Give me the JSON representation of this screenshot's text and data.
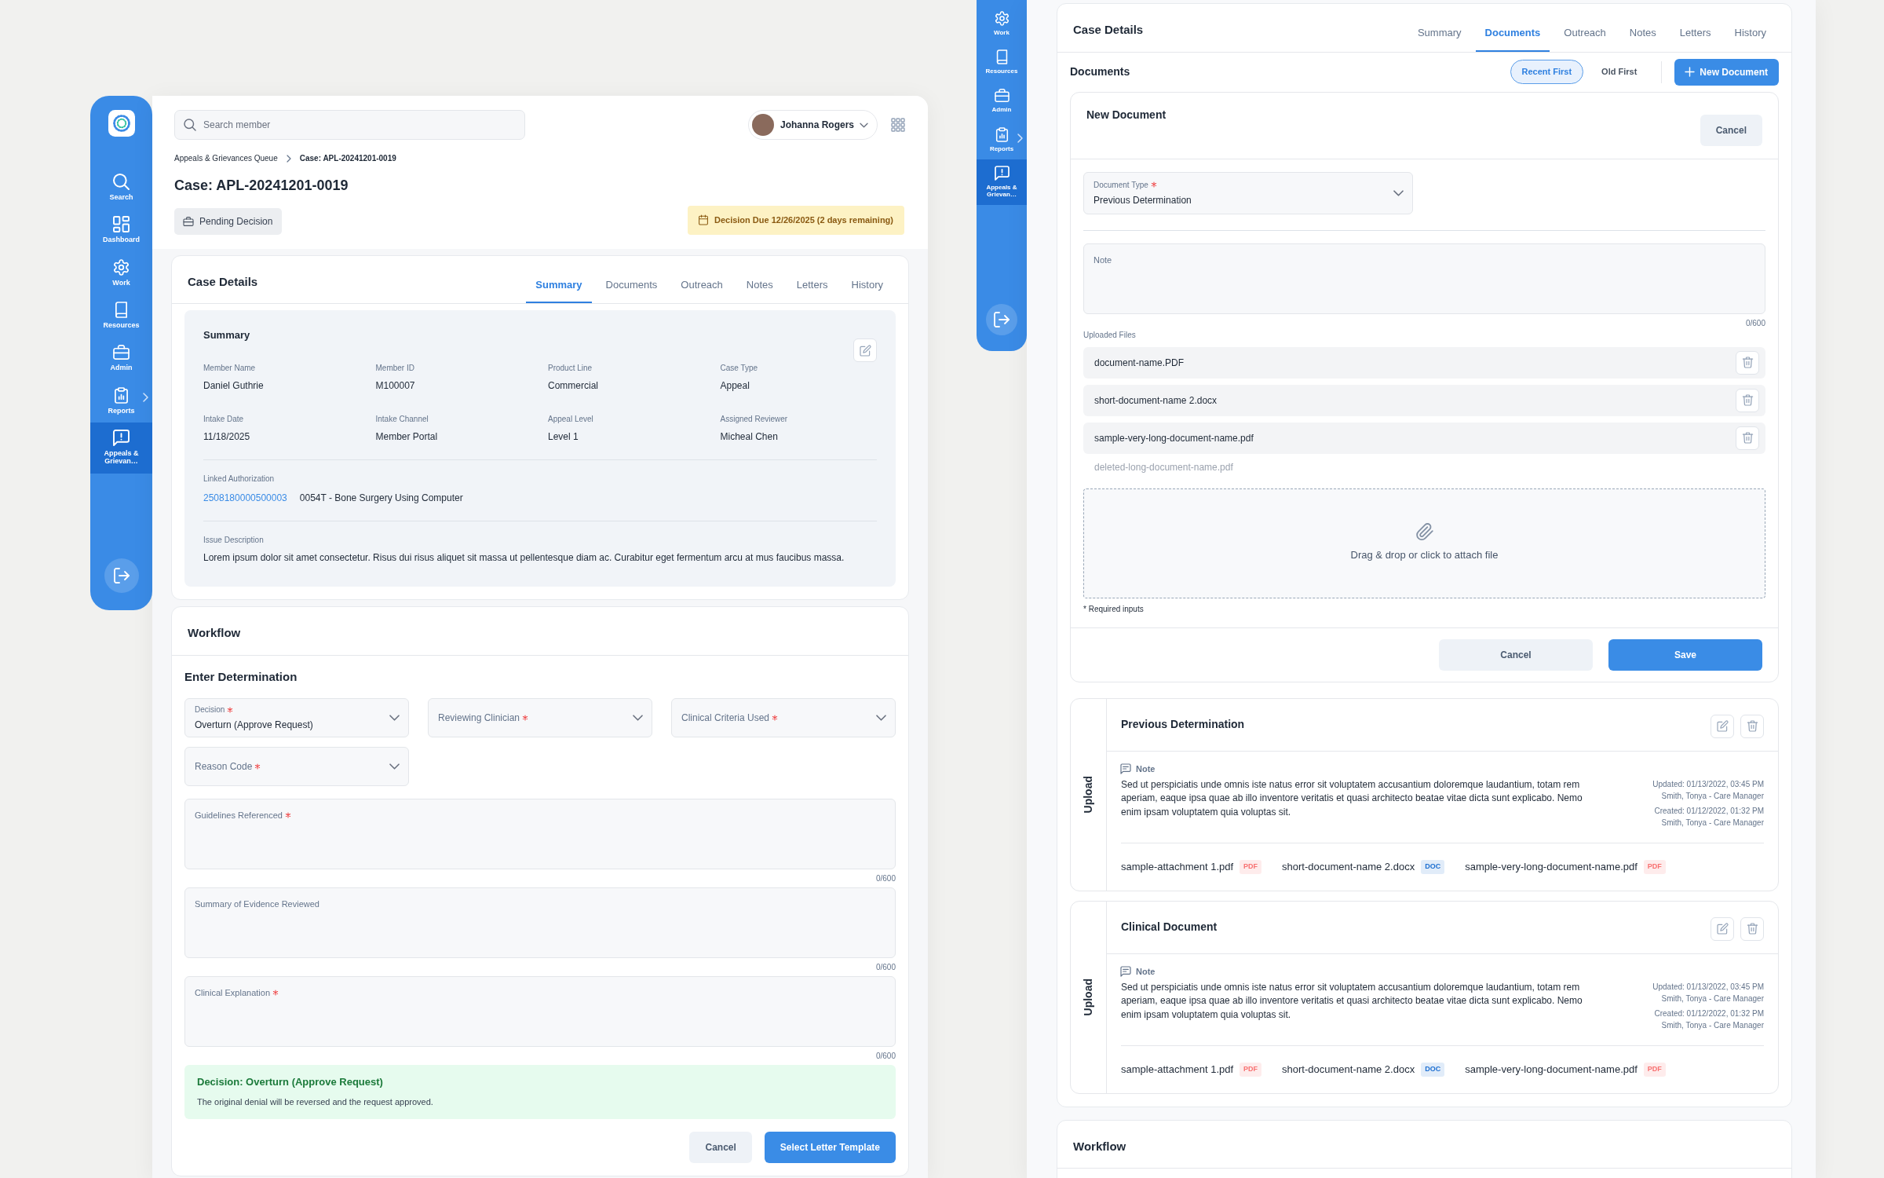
{
  "left_screen": {
    "sidebar": {
      "items": [
        {
          "label": "Search",
          "selected": false,
          "has_submenu": false
        },
        {
          "label": "Dashboard",
          "selected": false,
          "has_submenu": false
        },
        {
          "label": "Work",
          "selected": false,
          "has_submenu": false
        },
        {
          "label": "Resources",
          "selected": false,
          "has_submenu": false
        },
        {
          "label": "Admin",
          "selected": false,
          "has_submenu": false
        },
        {
          "label": "Reports",
          "selected": false,
          "has_submenu": true
        },
        {
          "label": "Appeals & Grievan…",
          "selected": true,
          "has_submenu": false
        }
      ]
    },
    "search": {
      "placeholder": "Search member"
    },
    "user": {
      "name": "Johanna Rogers"
    },
    "breadcrumb": [
      {
        "label": "Appeals & Grievances Queue"
      },
      {
        "label": "Case: APL-20241201-0019"
      }
    ],
    "title": "Case: APL-20241201-0019",
    "status": "Pending Decision",
    "due": "Decision Due 12/26/2025 (2 days remaining)",
    "case_details": {
      "title": "Case Details",
      "tabs": [
        {
          "label": "Summary",
          "selected": true
        },
        {
          "label": "Documents",
          "selected": false
        },
        {
          "label": "Outreach",
          "selected": false
        },
        {
          "label": "Notes",
          "selected": false
        },
        {
          "label": "Letters",
          "selected": false
        },
        {
          "label": "History",
          "selected": false
        }
      ],
      "summary": {
        "title": "Summary",
        "fields": [
          {
            "label": "Member Name",
            "value": "Daniel Guthrie"
          },
          {
            "label": "Member ID",
            "value": "M100007"
          },
          {
            "label": "Product Line",
            "value": "Commercial"
          },
          {
            "label": "Case Type",
            "value": "Appeal"
          },
          {
            "label": "Intake Date",
            "value": "11/18/2025"
          },
          {
            "label": "Intake Channel",
            "value": "Member Portal"
          },
          {
            "label": "Appeal Level",
            "value": "Level 1"
          },
          {
            "label": "Assigned Reviewer",
            "value": "Micheal Chen"
          }
        ],
        "linked_authorization": {
          "label": "Linked Authorization",
          "link": "2508180000500003",
          "description": "0054T - Bone Surgery Using Computer"
        },
        "issue_description": {
          "label": "Issue Description",
          "text": "Lorem ipsum dolor sit amet consectetur. Risus dui risus aliquet sit massa ut pellentesque diam ac. Curabitur eget fermentum arcu at mus faucibus massa."
        }
      }
    },
    "workflow": {
      "title": "Workflow",
      "section_title": "Enter Determination",
      "selects": [
        {
          "label": "Decision",
          "required": true,
          "value": "Overturn (Approve Request)"
        },
        {
          "label": "Reviewing Clinician",
          "required": true
        },
        {
          "label": "Clinical Criteria Used",
          "required": true
        },
        {
          "label": "Reason Code",
          "required": true
        }
      ],
      "textareas": [
        {
          "label": "Guidelines Referenced",
          "required": true,
          "counter": "0/600"
        },
        {
          "label": "Summary of Evidence Reviewed",
          "required": false,
          "counter": "0/600"
        },
        {
          "label": "Clinical Explanation",
          "required": true,
          "counter": "0/600"
        }
      ],
      "alert": {
        "title": "Decision: Overturn (Approve Request)",
        "text": "The original denial will be reversed and the request approved."
      },
      "buttons": [
        {
          "label": "Cancel",
          "kind": "secondary"
        },
        {
          "label": "Select Letter Template",
          "kind": "primary"
        }
      ]
    }
  },
  "right_screen": {
    "sidebar": {
      "items": [
        {
          "label": "Work",
          "selected": false,
          "has_submenu": false
        },
        {
          "label": "Resources",
          "selected": false,
          "has_submenu": false
        },
        {
          "label": "Admin",
          "selected": false,
          "has_submenu": false
        },
        {
          "label": "Reports",
          "selected": false,
          "has_submenu": true
        },
        {
          "label": "Appeals & Grievan…",
          "selected": true,
          "has_submenu": false
        }
      ]
    },
    "case_details": {
      "title": "Case Details",
      "tabs": [
        {
          "label": "Summary",
          "selected": false
        },
        {
          "label": "Documents",
          "selected": true
        },
        {
          "label": "Outreach",
          "selected": false
        },
        {
          "label": "Notes",
          "selected": false
        },
        {
          "label": "Letters",
          "selected": false
        },
        {
          "label": "History",
          "selected": false
        }
      ]
    },
    "documents": {
      "title": "Documents",
      "sort_options": [
        {
          "label": "Recent First",
          "selected": true
        },
        {
          "label": "Old First",
          "selected": false
        }
      ],
      "new_button": "New Document",
      "new_document": {
        "title": "New Document",
        "cancel": "Cancel",
        "document_type": {
          "label": "Document Type",
          "required": true,
          "value": "Previous Determination"
        },
        "note": {
          "label": "Note",
          "counter": "0/600"
        },
        "uploaded_files_label": "Uploaded Files",
        "files": [
          {
            "name": "document-name.PDF",
            "deleted": false
          },
          {
            "name": "short-document-name 2.docx",
            "deleted": false
          },
          {
            "name": "sample-very-long-document-name.pdf",
            "deleted": false
          },
          {
            "name": "deleted-long-document-name.pdf",
            "deleted": true
          }
        ],
        "dropzone": "Drag & drop or click to attach file",
        "required_note": "* Required inputs",
        "buttons": [
          {
            "label": "Cancel",
            "kind": "secondary"
          },
          {
            "label": "Save",
            "kind": "primary"
          }
        ]
      },
      "entries": [
        {
          "side_label": "Upload",
          "title": "Previous Determination",
          "note_label": "Note",
          "note": "Sed ut perspiciatis unde omnis iste natus error sit voluptatem accusantium doloremque laudantium, totam rem aperiam, eaque ipsa quae ab illo inventore veritatis et quasi architecto beatae vitae dicta sunt explicabo. Nemo enim ipsam voluptatem quia voluptas sit.",
          "updated": "Updated: 01/13/2022, 03:45 PM",
          "updated_by": "Smith, Tonya - Care Manager",
          "created": "Created: 01/12/2022, 01:32 PM",
          "created_by": "Smith, Tonya - Care Manager",
          "attachments": [
            {
              "name": "sample-attachment 1.pdf",
              "type": "PDF",
              "color": "#f87171"
            },
            {
              "name": "short-document-name 2.docx",
              "type": "DOC",
              "color": "#1d6fd1"
            },
            {
              "name": "sample-very-long-document-name.pdf",
              "type": "PDF",
              "color": "#f87171"
            }
          ]
        },
        {
          "side_label": "Upload",
          "title": "Clinical Document",
          "note_label": "Note",
          "note": "Sed ut perspiciatis unde omnis iste natus error sit voluptatem accusantium doloremque laudantium, totam rem aperiam, eaque ipsa quae ab illo inventore veritatis et quasi architecto beatae vitae dicta sunt explicabo. Nemo enim ipsam voluptatem quia voluptas sit.",
          "updated": "Updated: 01/13/2022, 03:45 PM",
          "updated_by": "Smith, Tonya - Care Manager",
          "created": "Created: 01/12/2022, 01:32 PM",
          "created_by": "Smith, Tonya - Care Manager",
          "attachments": [
            {
              "name": "sample-attachment 1.pdf",
              "type": "PDF",
              "color": "#f87171"
            },
            {
              "name": "short-document-name 2.docx",
              "type": "DOC",
              "color": "#1d6fd1"
            },
            {
              "name": "sample-very-long-document-name.pdf",
              "type": "PDF",
              "color": "#f87171"
            }
          ]
        }
      ]
    },
    "workflow": {
      "title": "Workflow"
    }
  }
}
